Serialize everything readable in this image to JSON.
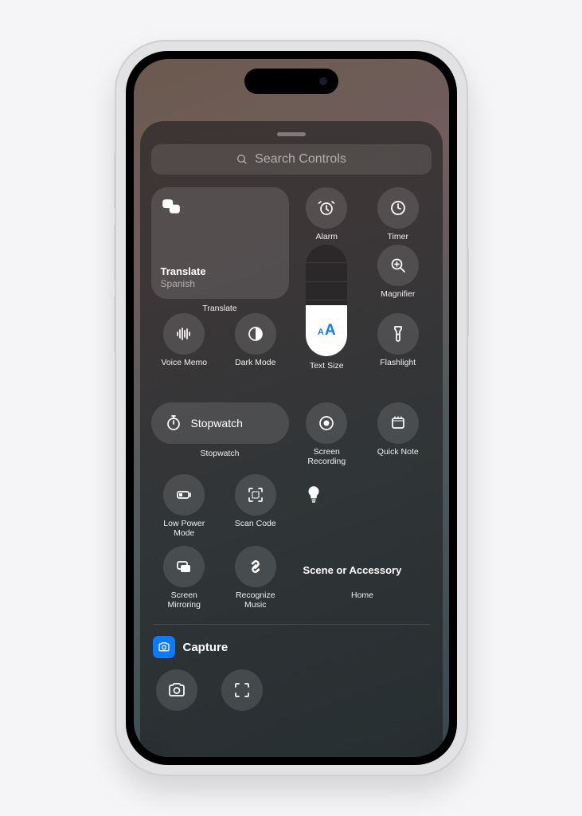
{
  "search": {
    "placeholder": "Search Controls"
  },
  "translate": {
    "title": "Translate",
    "subtitle": "Spanish",
    "label": "Translate"
  },
  "controls": {
    "alarm": "Alarm",
    "timer": "Timer",
    "magnifier": "Magnifier",
    "voiceMemo": "Voice Memo",
    "darkMode": "Dark Mode",
    "textSize": "Text Size",
    "flashlight": "Flashlight",
    "stopwatch": "Stopwatch",
    "stopwatchLabel": "Stopwatch",
    "screenRecording": "Screen\nRecording",
    "quickNote": "Quick Note",
    "lowPower": "Low Power\nMode",
    "scanCode": "Scan Code",
    "screenMirroring": "Screen\nMirroring",
    "recognizeMusic": "Recognize\nMusic"
  },
  "home": {
    "title": "Scene or Accessory",
    "label": "Home"
  },
  "captureSection": {
    "title": "Capture"
  }
}
